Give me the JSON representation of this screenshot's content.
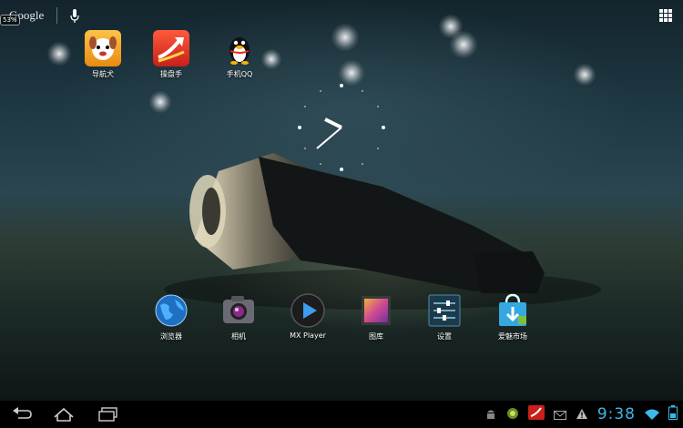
{
  "top_bar": {
    "search_logo_text": "Google",
    "battery_badge": "53%",
    "icons": [
      "mic-icon",
      "apps-grid-icon"
    ]
  },
  "top_apps": [
    {
      "label": "导航犬",
      "icon": "dog-navigation-icon",
      "color": "#f0a02a"
    },
    {
      "label": "操盘手",
      "icon": "trader-arrow-icon",
      "color": "#e43a2a"
    },
    {
      "label": "手机QQ",
      "icon": "qq-penguin-icon",
      "color": "#111111"
    }
  ],
  "dock_apps": [
    {
      "label": "浏览器",
      "icon": "globe-icon",
      "color": "#2b7fd6"
    },
    {
      "label": "相机",
      "icon": "camera-icon",
      "color": "#7a7a86"
    },
    {
      "label": "MX Player",
      "icon": "play-icon",
      "color": "#2a82e0"
    },
    {
      "label": "图库",
      "icon": "gallery-icon",
      "color": "#c84a8a"
    },
    {
      "label": "设置",
      "icon": "settings-sliders-icon",
      "color": "#2a7fa8"
    },
    {
      "label": "爱魅市场",
      "icon": "market-bag-icon",
      "color": "#36a8e0"
    }
  ],
  "status_bar": {
    "time": "9:38",
    "accent_color": "#3fb7e8",
    "notification_icons": [
      "android-debug-icon",
      "green-circle-icon",
      "trader-notify-icon",
      "email-icon",
      "warning-icon"
    ],
    "system_icons": [
      "wifi-icon",
      "battery-icon"
    ]
  },
  "nav_buttons": [
    "back-icon",
    "home-icon",
    "recent-apps-icon"
  ]
}
